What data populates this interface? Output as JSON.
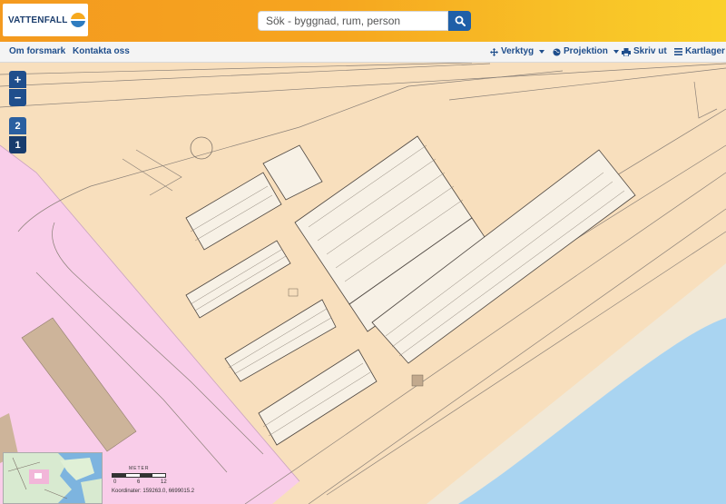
{
  "header": {
    "logo_text": "VATTENFALL",
    "search_placeholder": "Sök - byggnad, rum, person",
    "colors": {
      "accent": "#1f4e8c",
      "brand_orange": "#f49a1f"
    }
  },
  "nav": {
    "left": [
      "Om forsmark",
      "Kontakta oss"
    ],
    "tools_label": "Verktyg",
    "projection_label": "Projektion",
    "print_label": "Skriv ut",
    "layers_label": "Kartlager"
  },
  "map_controls": {
    "zoom_in": "+",
    "zoom_out": "−",
    "levels": [
      "2",
      "1"
    ]
  },
  "scale": {
    "title": "METER",
    "ticks": [
      "0",
      "6",
      "12"
    ],
    "coordinates": "Koordinater: 159263.0, 6699015.2"
  }
}
